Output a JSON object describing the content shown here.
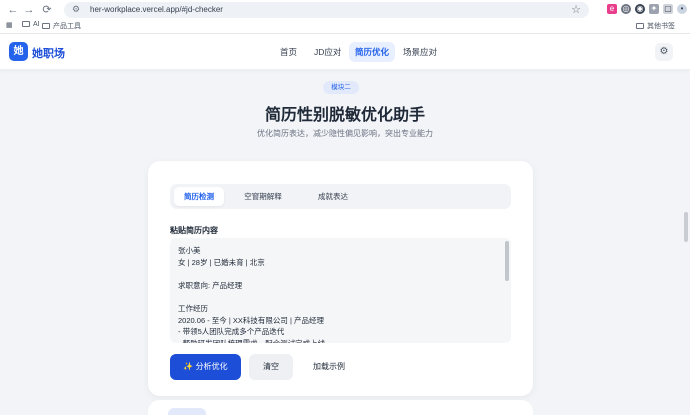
{
  "browser": {
    "url": "her-workplace.vercel.app/#jd-checker",
    "bookmarks": [
      {
        "label": "AI"
      },
      {
        "label": "产品工具"
      }
    ],
    "other_bookmarks": "其他书签"
  },
  "app": {
    "logo_char": "她",
    "name": "她职场",
    "nav": [
      {
        "label": "首页",
        "active": false
      },
      {
        "label": "JD应对",
        "active": false
      },
      {
        "label": "简历优化",
        "active": true
      },
      {
        "label": "场景应对",
        "active": false
      }
    ]
  },
  "hero": {
    "badge": "模块二",
    "title": "简历性别脱敏优化助手",
    "subtitle": "优化简历表达，减少隐性偏见影响，突出专业能力"
  },
  "card": {
    "tabs": [
      {
        "label": "简历检测",
        "active": true
      },
      {
        "label": "空窗期解释",
        "active": false
      },
      {
        "label": "成就表达",
        "active": false
      }
    ],
    "field_label": "粘贴简历内容",
    "resume_text": "张小美\n女 | 28岁 | 已婚未育 | 北京\n\n求职意向: 产品经理\n\n工作经历\n2020.06 - 至今 | XX科技有限公司 | 产品经理\n- 带领5人团队完成多个产品迭代\n- 帮助研发团队梳理需求，配合测试完成上线\n- 性格温柔细心，善于沟通协调，有亲和力",
    "buttons": {
      "analyze": "分析优化",
      "clear": "清空",
      "load_example": "加载示例"
    }
  },
  "colors": {
    "accent": "#2563eb",
    "primary_button": "#1d4ed8",
    "background": "#f2f4f8"
  }
}
